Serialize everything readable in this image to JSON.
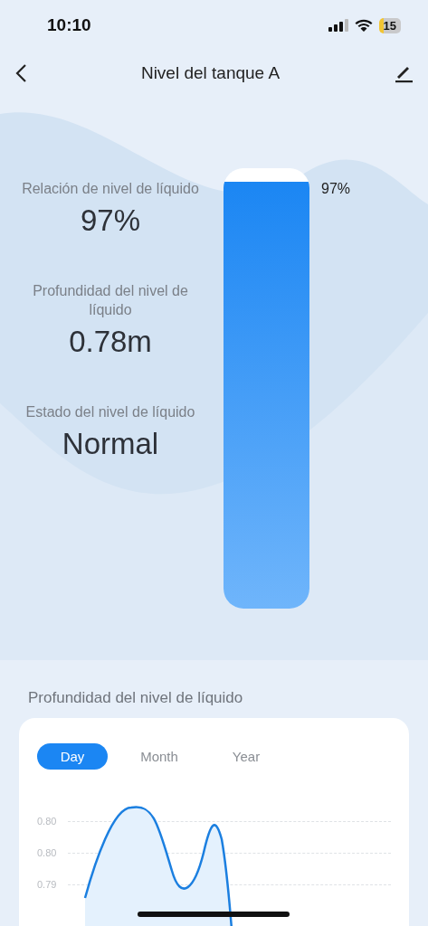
{
  "status_bar": {
    "time": "10:10",
    "battery": "15"
  },
  "nav": {
    "title": "Nivel del tanque A"
  },
  "metrics": [
    {
      "label": "Relación de nivel de líquido",
      "value": "97%"
    },
    {
      "label": "Profundidad del nivel de líquido",
      "value": "0.78m"
    },
    {
      "label": "Estado del nivel de líquido",
      "value": "Normal"
    }
  ],
  "tank": {
    "level": 0.97,
    "reading": "97%"
  },
  "history": {
    "title": "Profundidad del nivel de líquido",
    "tabs": [
      {
        "label": "Day",
        "selected": true
      },
      {
        "label": "Month",
        "selected": false
      },
      {
        "label": "Year",
        "selected": false
      }
    ],
    "y_tick_labels": [
      "0.80",
      "0.80",
      "0.79"
    ]
  }
}
